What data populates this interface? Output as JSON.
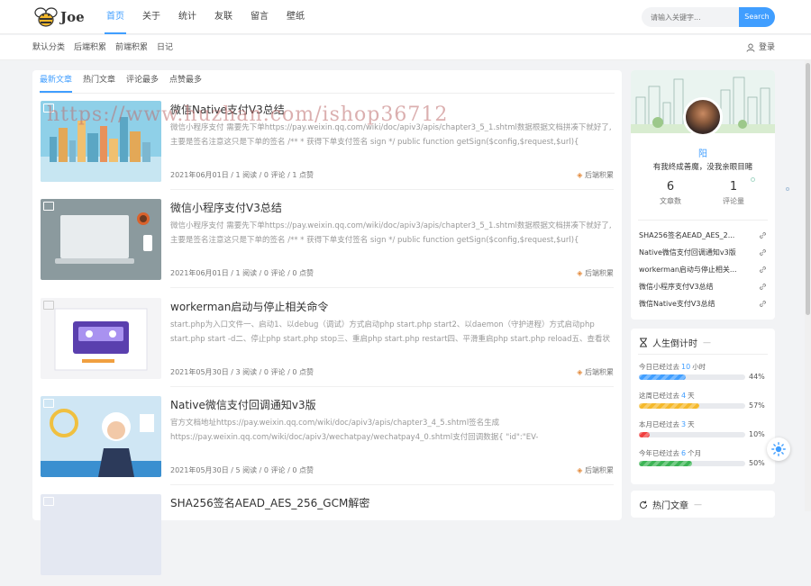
{
  "header": {
    "logo_text": "Joe",
    "nav": [
      "首页",
      "关于",
      "统计",
      "友联",
      "留言",
      "壁纸"
    ],
    "search_placeholder": "请输入关键字...",
    "search_button": "Search"
  },
  "subnav": {
    "items": [
      "默认分类",
      "后端积累",
      "前端积累",
      "日记"
    ],
    "login": "登录"
  },
  "main": {
    "tabs": [
      "最新文章",
      "热门文章",
      "评论最多",
      "点赞最多"
    ],
    "posts": [
      {
        "title": "微信Native支付V3总结",
        "excerpt": "微信小程序支付 需要先下单https://pay.weixin.qq.com/wiki/doc/apiv3/apis/chapter3_5_1.shtml数据根据文档拼凑下就好了,主要是签名注意这只是下单的签名 /** * 获得下单支付签名 sign */ public function getSign($config,$request,$url){ $url_parts = ...",
        "meta": "2021年06月01日 / 1 阅读 / 0 评论 / 1 点赞",
        "category": "后端积累"
      },
      {
        "title": "微信小程序支付V3总结",
        "excerpt": "微信小程序支付 需要先下单https://pay.weixin.qq.com/wiki/doc/apiv3/apis/chapter3_5_1.shtml数据根据文档拼凑下就好了,主要是签名注意这只是下单的签名 /** * 获得下单支付签名 sign */ public function getSign($config,$request,$url){ $url_parts = ...",
        "meta": "2021年06月01日 / 1 阅读 / 0 评论 / 0 点赞",
        "category": "后端积累"
      },
      {
        "title": "workerman启动与停止相关命令",
        "excerpt": "start.php为入口文件一、启动1、以debug（调试）方式启动php start.php start2、以daemon（守护进程）方式启动php start.php start -d二、停止php start.php stop三、重启php start.php restart四、平滑重启php start.php reload五、查看状态php st...",
        "meta": "2021年05月30日 / 3 阅读 / 0 评论 / 0 点赞",
        "category": "后端积累"
      },
      {
        "title": "Native微信支付回调通知v3版",
        "excerpt": "官方文档地址https://pay.weixin.qq.com/wiki/doc/apiv3/apis/chapter3_4_5.shtml签名生成https://pay.weixin.qq.com/wiki/doc/apiv3/wechatpay/wechatpay4_0.shtml支付回调数据{ \"id\":\"EV-2018022511223320873\", \"create_time\":\"2015-05-20T13:29:3...",
        "meta": "2021年05月30日 / 5 阅读 / 0 评论 / 0 点赞",
        "category": "后端积累"
      },
      {
        "title": "SHA256签名AEAD_AES_256_GCM解密",
        "excerpt": "",
        "meta": "",
        "category": ""
      }
    ]
  },
  "profile": {
    "name": "阳",
    "motto": "有我终成善魔，没我亲眼目睹",
    "posts_count": "6",
    "posts_label": "文章数",
    "comments_count": "1",
    "comments_label": "评论量",
    "recent": [
      "SHA256签名AEAD_AES_2...",
      "Native微信支付回调通知v3版",
      "workerman启动与停止相关...",
      "微信小程序支付V3总结",
      "微信Native支付V3总结"
    ]
  },
  "countdown": {
    "title": "人生倒计时",
    "rows": [
      {
        "prefix": "今日已经过去",
        "value": "10",
        "unit": "小时",
        "percent": "44%",
        "fraction": 0.44,
        "color": "#409eff"
      },
      {
        "prefix": "这周已经过去",
        "value": "4",
        "unit": "天",
        "percent": "57%",
        "fraction": 0.57,
        "color": "#f5b92b"
      },
      {
        "prefix": "本月已经过去",
        "value": "3",
        "unit": "天",
        "percent": "10%",
        "fraction": 0.1,
        "color": "#f03e3e"
      },
      {
        "prefix": "今年已经过去",
        "value": "6",
        "unit": "个月",
        "percent": "50%",
        "fraction": 0.5,
        "color": "#3cb455"
      }
    ]
  },
  "hot": {
    "title": "热门文章"
  },
  "watermark": "https://www.huzhan.com/ishop36712"
}
